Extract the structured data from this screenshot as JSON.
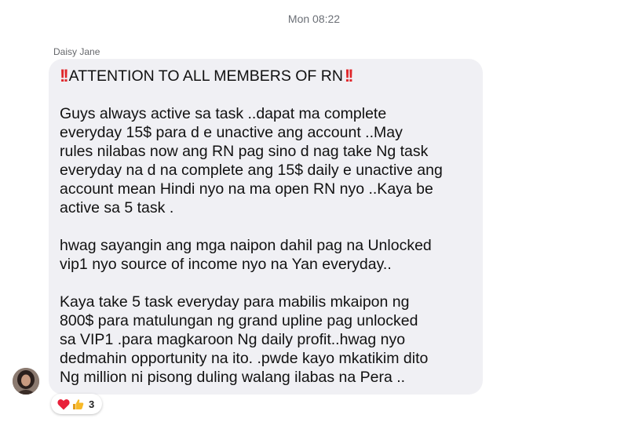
{
  "chat": {
    "timestamp": "Mon 08:22",
    "sender_name": "Daisy Jane"
  },
  "message": {
    "title": "ATTENTION TO ALL MEMBERS OF RN",
    "paragraphs": [
      {
        "lines": [
          "Guys always active sa task ..dapat ma complete",
          "everyday 15$ para d e unactive  ang account ..May",
          "rules nilabas now ang RN pag sino d nag take Ng task",
          "everyday na d na complete ang 15$ daily e unactive ang",
          "account mean Hindi nyo na ma open RN nyo ..Kaya be",
          "active sa 5 task ."
        ]
      },
      {
        "lines": [
          "hwag sayangin ang mga naipon dahil pag na Unlocked",
          "vip1 nyo source of income nyo na Yan everyday.."
        ]
      },
      {
        "lines": [
          "Kaya take 5 task everyday para mabilis mkaipon ng",
          "800$ para matulungan ng grand upline pag unlocked",
          "sa VIP1 .para magkaroon Ng daily profit..hwag nyo",
          "dedmahin opportunity na ito. .pwde kayo mkatikim dito",
          "Ng million ni pisong duling walang ilabas na Pera .."
        ]
      }
    ]
  },
  "reactions": {
    "icons": [
      "heart-icon",
      "thumbs-up-icon"
    ],
    "count": "3"
  },
  "colors": {
    "bubble_bg": "#f0f0f4",
    "double_exclamation": "#e0262a",
    "heart": "#e8203a",
    "thumbs_up": "#f7b928"
  }
}
